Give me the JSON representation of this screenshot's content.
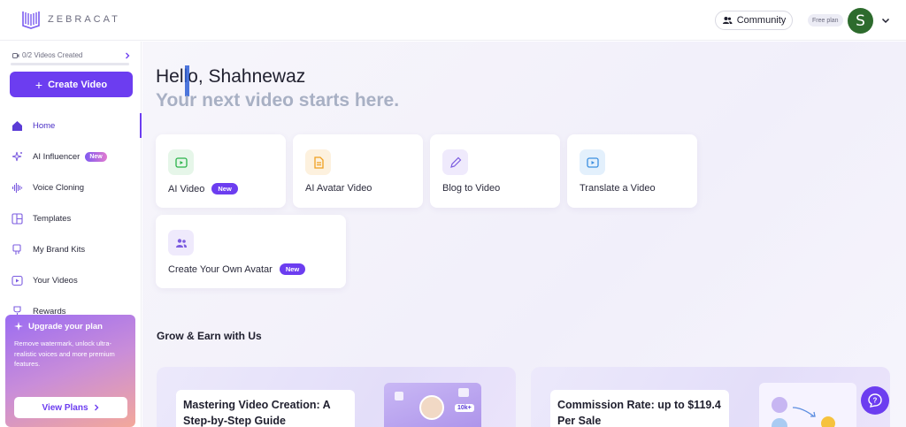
{
  "header": {
    "logo_text": "ZEBRACAT",
    "community_label": "Community",
    "plan_badge": "Free plan",
    "avatar_initial": "S"
  },
  "sidebar": {
    "videos_created": "0/2 Videos Created",
    "videos_progress_fraction": 0,
    "create_label": "Create Video",
    "items": [
      {
        "label": "Home",
        "icon": "home-icon",
        "active": true
      },
      {
        "label": "AI Influencer",
        "icon": "sparkle-icon",
        "tag": "New"
      },
      {
        "label": "Voice Cloning",
        "icon": "waveform-icon"
      },
      {
        "label": "Templates",
        "icon": "templates-icon"
      },
      {
        "label": "My Brand Kits",
        "icon": "brand-kit-icon"
      },
      {
        "label": "Your Videos",
        "icon": "video-icon"
      },
      {
        "label": "Rewards",
        "icon": "trophy-icon"
      }
    ],
    "upgrade": {
      "title": "Upgrade your plan",
      "description": "Remove watermark, unlock ultra-realistic voices and more premium features.",
      "cta": "View Plans"
    }
  },
  "main": {
    "greeting": "Hello, Shahnewaz",
    "subtitle": "Your next video starts here.",
    "cards": [
      {
        "label": "AI Video",
        "tag": "New",
        "icon": "play-icon",
        "color": "#2bb34a",
        "bg": "#e6f6e9"
      },
      {
        "label": "AI Avatar Video",
        "icon": "document-icon",
        "color": "#f0a020",
        "bg": "#fdf1de"
      },
      {
        "label": "Blog to Video",
        "icon": "pen-icon",
        "color": "#7c5ce0",
        "bg": "#efeafc"
      },
      {
        "label": "Translate a Video",
        "icon": "video-icon",
        "color": "#3c8fe0",
        "bg": "#e3f0fc"
      },
      {
        "label": "Create Your Own Avatar",
        "tag": "New",
        "icon": "users-icon",
        "color": "#7c5ce0",
        "bg": "#efeafc"
      }
    ],
    "section_title": "Grow & Earn with Us",
    "promos": [
      {
        "title": "Mastering Video Creation: A Step-by-Step Guide",
        "art_label": "10k+"
      },
      {
        "title": "Commission Rate: up to $119.4 Per Sale"
      }
    ]
  },
  "colors": {
    "accent": "#6c3df0"
  }
}
